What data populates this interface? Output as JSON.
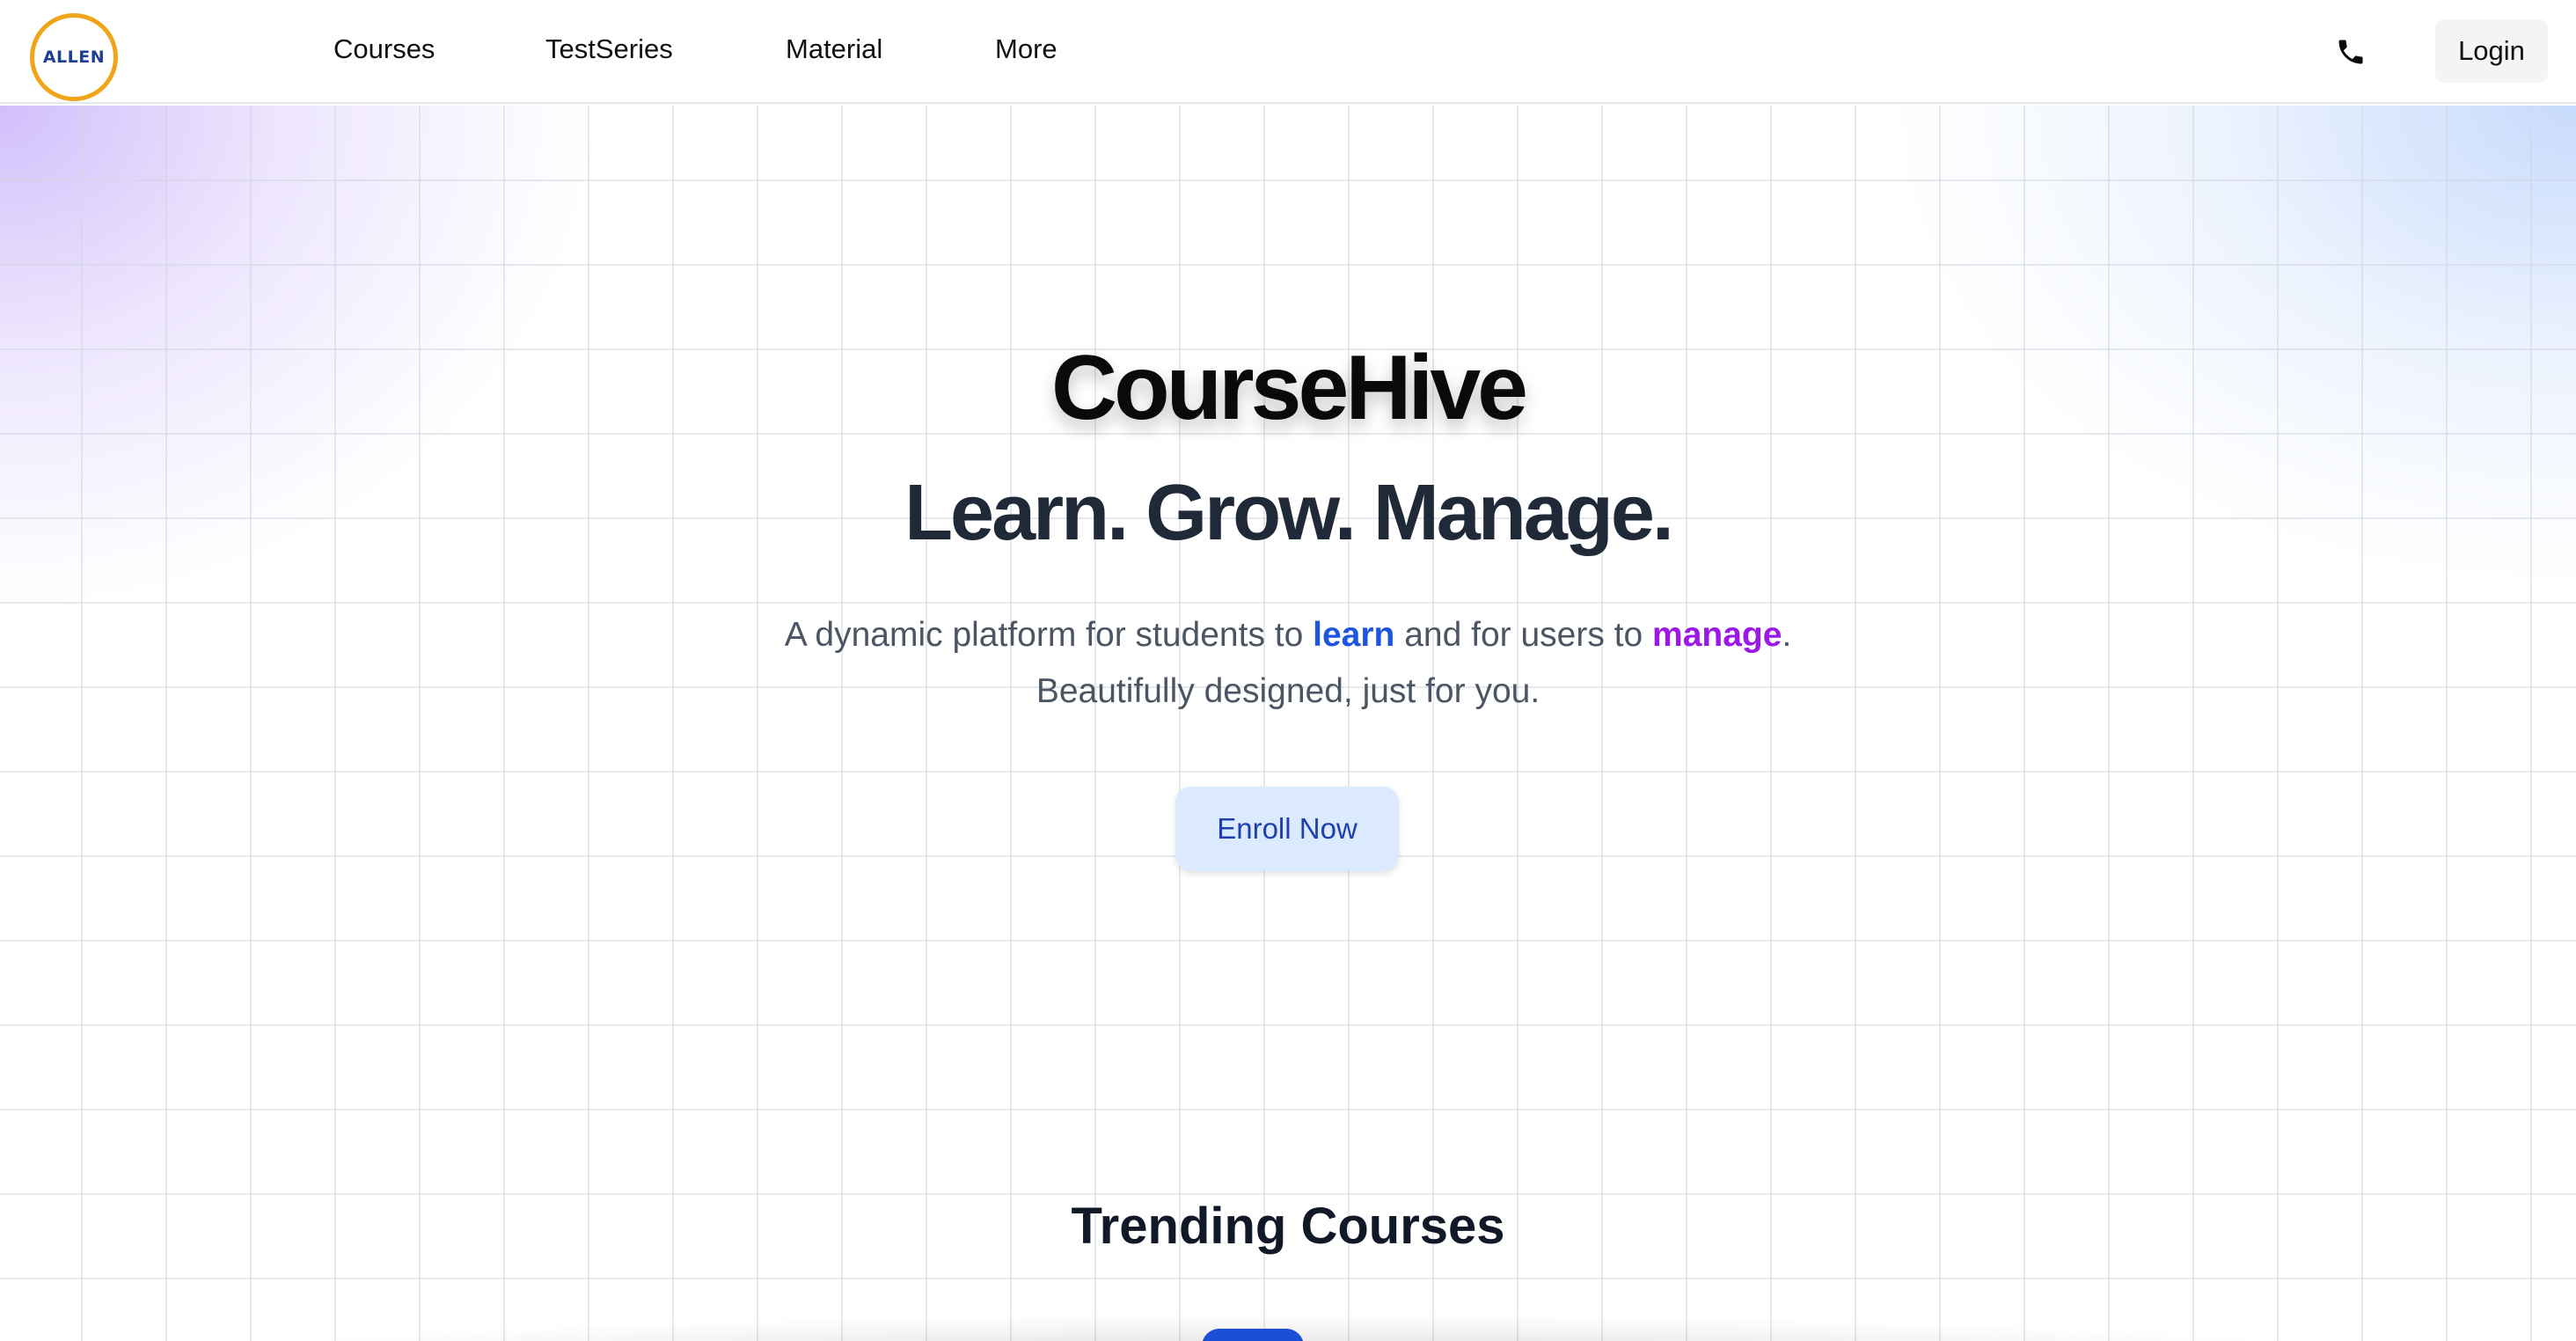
{
  "logo": {
    "text": "ALLEN",
    "ring_color": "#f0a418",
    "text_color": "#1f3f93"
  },
  "nav": {
    "items": [
      {
        "label": "Courses"
      },
      {
        "label": "TestSeries"
      },
      {
        "label": "Material"
      },
      {
        "label": "More"
      }
    ],
    "phone_icon": "phone-icon",
    "login_label": "Login"
  },
  "hero": {
    "brand": "CourseHive",
    "tagline": "Learn. Grow. Manage.",
    "description": {
      "part1": "A dynamic platform for students to ",
      "learn_word": "learn",
      "part2": " and for users to ",
      "manage_word": "manage",
      "part3": ".",
      "line2": "Beautifully designed, just for you."
    },
    "cta_label": "Enroll Now"
  },
  "trending": {
    "title": "Trending Courses"
  },
  "colors": {
    "learn": "#1d55e0",
    "manage": "#9b18e6",
    "cta_bg": "#dbeafe",
    "cta_text": "#1e40af"
  }
}
